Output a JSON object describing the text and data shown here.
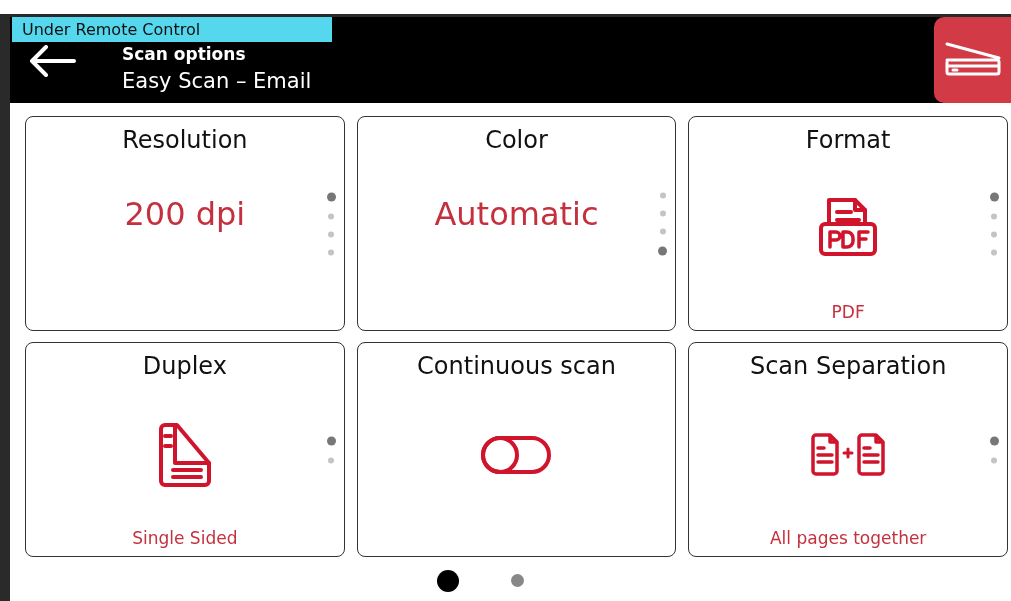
{
  "banner": "Under Remote Control",
  "header": {
    "title": "Scan options",
    "subtitle": "Easy Scan – Email"
  },
  "cards": [
    {
      "kind": "text",
      "title": "Resolution",
      "value": "200 dpi",
      "dots": [
        {
          "selected": true
        },
        {
          "selected": false
        },
        {
          "selected": false
        },
        {
          "selected": false
        }
      ]
    },
    {
      "kind": "text",
      "title": "Color",
      "value": "Automatic",
      "dots": [
        {
          "selected": false
        },
        {
          "selected": false
        },
        {
          "selected": false
        },
        {
          "selected": true
        }
      ]
    },
    {
      "kind": "pdf",
      "title": "Format",
      "value": "PDF",
      "dots": [
        {
          "selected": true
        },
        {
          "selected": false
        },
        {
          "selected": false
        },
        {
          "selected": false
        }
      ]
    },
    {
      "kind": "duplex",
      "title": "Duplex",
      "value": "Single Sided",
      "dots": [
        {
          "selected": true
        },
        {
          "selected": false
        }
      ]
    },
    {
      "kind": "toggle",
      "title": "Continuous scan",
      "on": false
    },
    {
      "kind": "separation",
      "title": "Scan Separation",
      "value": "All pages together",
      "dots": [
        {
          "selected": true
        },
        {
          "selected": false
        }
      ]
    }
  ],
  "pages": [
    {
      "selected": true
    },
    {
      "selected": false
    }
  ]
}
